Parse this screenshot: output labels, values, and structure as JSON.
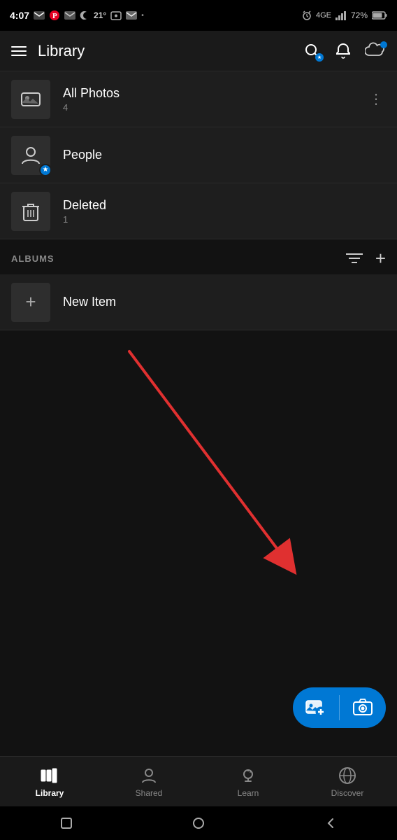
{
  "statusBar": {
    "time": "4:07",
    "battery": "72%",
    "signal": "4GE",
    "temperature": "21°"
  },
  "header": {
    "title": "Library",
    "menuIcon": "hamburger-icon",
    "searchIcon": "search-star-icon",
    "bellIcon": "bell-icon",
    "cloudIcon": "cloud-icon"
  },
  "listItems": [
    {
      "id": "all-photos",
      "title": "All Photos",
      "subtitle": "4",
      "icon": "image-icon",
      "hasMore": true
    },
    {
      "id": "people",
      "title": "People",
      "subtitle": "",
      "icon": "people-icon",
      "hasMore": false
    },
    {
      "id": "deleted",
      "title": "Deleted",
      "subtitle": "1",
      "icon": "trash-icon",
      "hasMore": false
    }
  ],
  "albumsSection": {
    "label": "ALBUMS",
    "sortIcon": "sort-icon",
    "addIcon": "add-icon"
  },
  "newItem": {
    "title": "New Item",
    "icon": "plus-icon"
  },
  "fab": {
    "addPhotoLabel": "add-photo-fab",
    "cameraLabel": "camera-fab"
  },
  "bottomNav": [
    {
      "id": "library",
      "label": "Library",
      "icon": "library-icon",
      "active": true
    },
    {
      "id": "shared",
      "label": "Shared",
      "icon": "shared-icon",
      "active": false
    },
    {
      "id": "learn",
      "label": "Learn",
      "icon": "learn-icon",
      "active": false
    },
    {
      "id": "discover",
      "label": "Discover",
      "icon": "discover-icon",
      "active": false
    }
  ],
  "androidNav": {
    "backIcon": "back-icon",
    "homeIcon": "home-icon",
    "recentIcon": "recent-icon"
  }
}
